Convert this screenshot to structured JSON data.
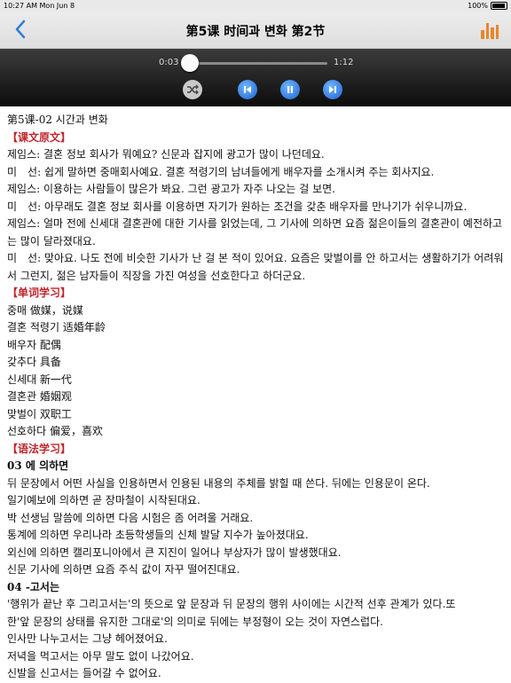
{
  "status_bar": {
    "time_date": "10:27 AM   Mon Jun 8",
    "battery": "100%"
  },
  "nav": {
    "title": "第5课 时间과 변화 第2节",
    "back_icon": "chevron-left-icon",
    "bars_icon": "bar-chart-icon"
  },
  "player": {
    "elapsed": "0:03",
    "duration": "1:12",
    "progress": 0.042,
    "buttons": [
      "shuffle-icon",
      "previous-icon",
      "pause-icon",
      "next-icon"
    ]
  },
  "content": {
    "lesson_title": "第5课-02 시간과 변화",
    "section1": "【课文原文】",
    "dialogue": [
      "제임스: 결혼 정보 회사가 뭐예요? 신문과 잡지에 광고가 많이 나던데요.",
      "미　선: 쉽게 말하면 중매회사예요. 결혼 적령기의 남녀들에게 배우자를 소개시켜 주는 회사지요.",
      "제임스: 이용하는 사람들이 많은가 봐요. 그런 광고가 자주 나오는 걸 보면.",
      "미　선: 아무래도 결혼 정보 회사를 이용하면 자기가 원하는 조건을 갖춘 배우자를 만나기가 쉬우니까요.",
      "제임스: 얼마 전에 신세대 결혼관에 대한 기사를 읽었는데, 그 기사에 의하면 요즘 젊은이들의 결혼관이 예전하고는 많이 달라졌대요.",
      "미　선: 맞아요. 나도 전에 비슷한 기사가 난 걸 본 적이 있어요. 요즘은 맞벌이를 안 하고서는 생활하기가 어려워서 그런지, 젊은 남자들이 직장을 가진 여성을 선호한다고 하더군요."
    ],
    "section2": "【单词学习】",
    "vocab": [
      "중매 做媒，说媒",
      "결혼 적령기 适婚年龄",
      "배우자 配偶",
      "갖추다 具备",
      "신세대 新一代",
      "결혼관 婚姻观",
      "맞벌이 双职工",
      "선호하다 偏爱，喜欢"
    ],
    "section3": "【语法学习】",
    "grammar1_title": "03 에 의하면",
    "grammar1_desc": "뒤 문장에서 어떤 사실을 인용하면서 인용된 내용의 주체를 밝힐 때 쓴다. 뒤에는 인용문이 온다.",
    "grammar1_examples": [
      "일기예보에 의하면 곧 장마철이 시작된대요.",
      "박 선생님 말씀에 의하면 다음 시험은 좀 어려울 거래요.",
      "통계에 의하면 우리나라 초등학생들의 신체 발달 지수가 높아졌대요.",
      "외신에 의하면 캘리포니아에서 큰 지진이 일어나 부상자가 많이 발생했대요.",
      "신문 기사에 의하면 요즘 주식 값이 자꾸 떨어진대요."
    ],
    "grammar2_title": "04 -고서는",
    "grammar2_desc_1": "'행위가 끝난 후 그리고서는'의 뜻으로 앞 문장과 뒤 문장의 행위 사이에는 시간적 선후 관계가 있다.또",
    "grammar2_desc_2": "한'앞 문장의 상태를 유지한 그대로'의 의미로 뒤에는 부정형이 오는 것이 자연스럽다.",
    "grammar2_examples": [
      "인사만 나누고서는 그냥 헤어졌어요.",
      "저녁을 먹고서는 아무 말도 없이 나갔어요.",
      "신발을 신고서는 들어갈 수 없어요."
    ]
  }
}
